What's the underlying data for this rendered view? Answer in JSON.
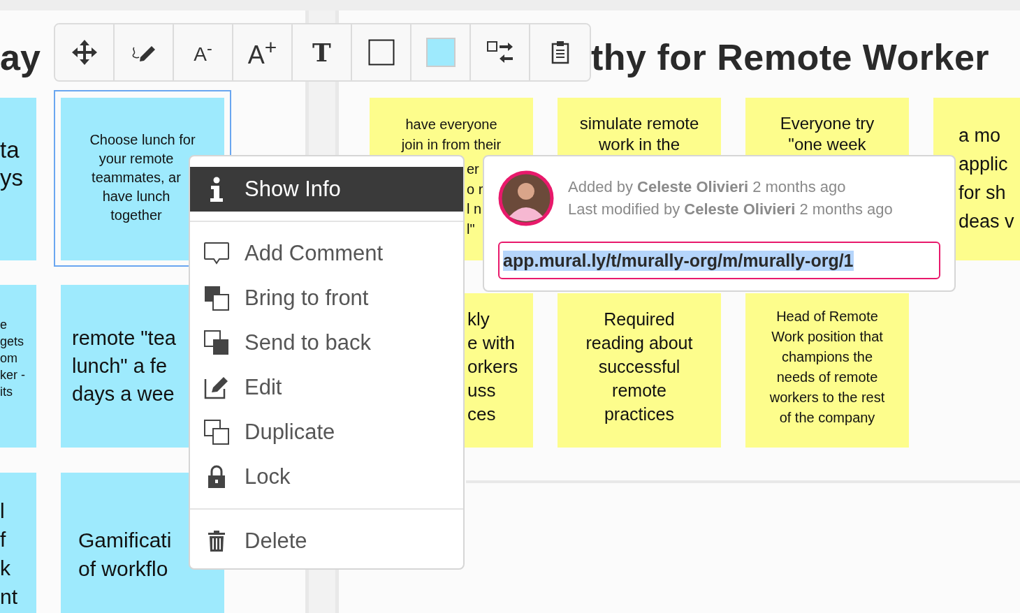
{
  "left_panel": {
    "title": "ay",
    "stickies": [
      {
        "color": "#9eeafd",
        "selected": false,
        "lines": [
          "ta",
          "ys"
        ]
      },
      {
        "color": "#9eeafd",
        "selected": true,
        "lines": [
          "Choose lunch for",
          "your remote",
          "teammates, ar",
          "have lunch",
          "together"
        ]
      },
      {
        "color": "#9eeafd",
        "selected": false,
        "lines": [
          "e",
          "gets",
          "om",
          "ker -",
          "its"
        ]
      },
      {
        "color": "#9eeafd",
        "selected": false,
        "lines": [
          "remote \"tea",
          "lunch\" a fe",
          "days a wee"
        ]
      },
      {
        "color": "#9eeafd",
        "selected": false,
        "lines": [
          "l",
          "f",
          "k",
          "nt"
        ]
      },
      {
        "color": "#9eeafd",
        "selected": false,
        "lines": [
          "Gamificati",
          "of workflo"
        ]
      }
    ]
  },
  "right_panel": {
    "title": "thy for Remote Worker",
    "stickies": [
      {
        "color": "#fdfd8c",
        "selected": false,
        "lines": [
          "have everyone",
          "join in from their",
          "er",
          "o r",
          "l n",
          "l\""
        ]
      },
      {
        "color": "#fdfd8c",
        "selected": false,
        "lines": [
          "simulate remote",
          "work in the"
        ]
      },
      {
        "color": "#fdfd8c",
        "selected": false,
        "lines": [
          "Everyone try",
          "\"one week"
        ]
      },
      {
        "color": "#fdfd8c",
        "selected": false,
        "lines": [
          "a mo",
          "applic",
          "for sh",
          "deas v"
        ]
      },
      {
        "color": "#fdfd8c",
        "selected": false,
        "lines": [
          "kly",
          "e with",
          "orkers",
          "uss",
          "ces"
        ]
      },
      {
        "color": "#fdfd8c",
        "selected": false,
        "lines": [
          "Required",
          "reading about",
          "successful",
          "remote",
          "practices"
        ]
      },
      {
        "color": "#fdfd8c",
        "selected": false,
        "lines": [
          "Head of Remote",
          "Work position that",
          "champions the",
          "needs of remote",
          "workers to the rest",
          "of the company"
        ]
      }
    ]
  },
  "toolbar": [
    {
      "kind": "move"
    },
    {
      "kind": "draw"
    },
    {
      "kind": "label",
      "label": "A$^{-}$"
    },
    {
      "kind": "label",
      "label": "A$^{+}$"
    },
    {
      "kind": "serif",
      "label": "T"
    },
    {
      "kind": "border"
    },
    {
      "kind": "swatch",
      "color": "#9eeafd"
    },
    {
      "kind": "swap"
    },
    {
      "kind": "clipboard"
    }
  ],
  "context_menu": {
    "items": [
      {
        "label": "Show Info",
        "selected": true
      },
      {
        "label": "Add Comment",
        "selected": false
      },
      {
        "label": "Bring to front",
        "selected": false
      },
      {
        "label": "Send to back",
        "selected": false
      },
      {
        "label": "Edit",
        "selected": false
      },
      {
        "label": "Duplicate",
        "selected": false
      },
      {
        "label": "Lock",
        "selected": false
      },
      {
        "label": "Delete",
        "selected": false
      }
    ]
  },
  "info_popup": {
    "added": "Added by **Celeste Olivieri** 2 months ago",
    "modified": "Last modified by **Celeste Olivieri** 2 months ago",
    "link": "app.mural.ly/t/murally-org/m/murally-org/1"
  }
}
